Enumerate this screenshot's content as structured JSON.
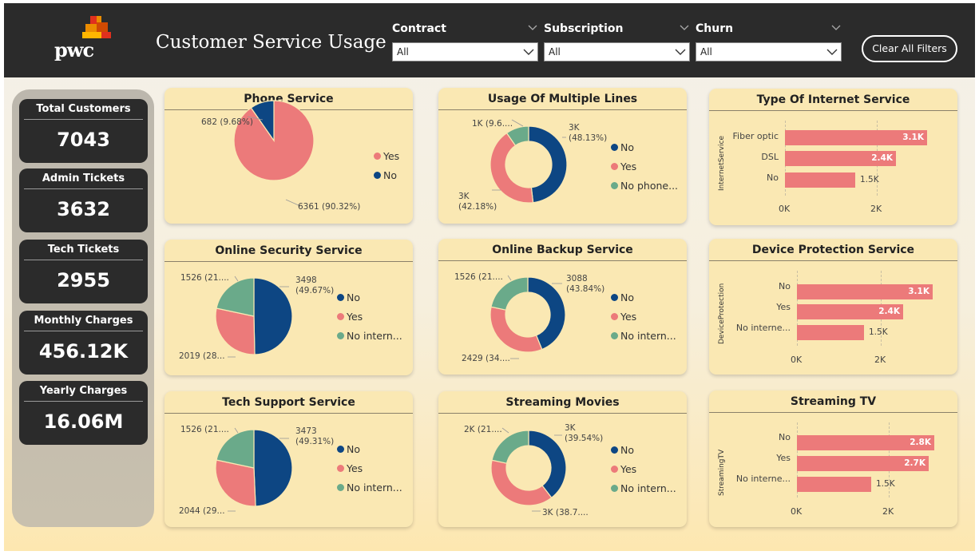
{
  "header": {
    "logo_text": "pwc",
    "title": "Customer Service Usage",
    "filters": [
      {
        "label": "Contract",
        "value": "All"
      },
      {
        "label": "Subscription",
        "value": "All"
      },
      {
        "label": "Churn",
        "value": "All"
      }
    ],
    "clear_button": "Clear All Filters"
  },
  "kpis": [
    {
      "label": "Total Customers",
      "value": "7043"
    },
    {
      "label": "Admin Tickets",
      "value": "3632"
    },
    {
      "label": "Tech Tickets",
      "value": "2955"
    },
    {
      "label": "Monthly Charges",
      "value": "456.12K"
    },
    {
      "label": "Yearly Charges",
      "value": "16.06M"
    }
  ],
  "colors": {
    "navy": "#0d4683",
    "salmon": "#ec7a7a",
    "green": "#6aaa8a",
    "card": "#fae8b3",
    "dark": "#2b2b2b"
  },
  "chart_data": [
    {
      "type": "pie",
      "title": "Phone Service",
      "legend": [
        "Yes",
        "No"
      ],
      "values": [
        6361,
        682
      ],
      "data_labels": [
        "6361 (90.32%)",
        "682 (9.68%)"
      ]
    },
    {
      "type": "pie",
      "subtype": "donut",
      "title": "Usage Of Multiple Lines",
      "legend": [
        "No",
        "Yes",
        "No phone..."
      ],
      "values": [
        3390,
        2971,
        682
      ],
      "data_labels": [
        "3K\n(48.13%)",
        "3K\n(42.18%)",
        "1K (9.6...."
      ]
    },
    {
      "type": "bar",
      "orientation": "horizontal",
      "title": "Type Of Internet Service",
      "ylabel": "InternetService",
      "categories": [
        "Fiber optic",
        "DSL",
        "No"
      ],
      "values": [
        3096,
        2421,
        1526
      ],
      "data_labels": [
        "3.1K",
        "2.4K",
        "1.5K"
      ],
      "x_ticks": [
        "0K",
        "2K"
      ]
    },
    {
      "type": "pie",
      "title": "Online Security Service",
      "legend": [
        "No",
        "Yes",
        "No intern..."
      ],
      "values": [
        3498,
        2019,
        1526
      ],
      "data_labels": [
        "3498\n(49.67%)",
        "2019 (28...",
        "1526 (21...."
      ]
    },
    {
      "type": "pie",
      "subtype": "donut",
      "title": "Online Backup Service",
      "legend": [
        "No",
        "Yes",
        "No intern..."
      ],
      "values": [
        3088,
        2429,
        1526
      ],
      "data_labels": [
        "3088\n(43.84%)",
        "2429 (34....",
        "1526 (21...."
      ]
    },
    {
      "type": "bar",
      "orientation": "horizontal",
      "title": "Device Protection Service",
      "ylabel": "DeviceProtection",
      "categories": [
        "No",
        "Yes",
        "No interne..."
      ],
      "values": [
        3095,
        2422,
        1526
      ],
      "data_labels": [
        "3.1K",
        "2.4K",
        "1.5K"
      ],
      "x_ticks": [
        "0K",
        "2K"
      ]
    },
    {
      "type": "pie",
      "title": "Tech Support Service",
      "legend": [
        "No",
        "Yes",
        "No intern..."
      ],
      "values": [
        3473,
        2044,
        1526
      ],
      "data_labels": [
        "3473\n(49.31%)",
        "2044 (29...",
        "1526 (21...."
      ]
    },
    {
      "type": "pie",
      "subtype": "donut",
      "title": "Streaming Movies",
      "legend": [
        "No",
        "Yes",
        "No intern..."
      ],
      "values": [
        2785,
        2732,
        1526
      ],
      "data_labels": [
        "3K\n(39.54%)",
        "3K (38.7....",
        "2K (21...."
      ]
    },
    {
      "type": "bar",
      "orientation": "horizontal",
      "title": "Streaming TV",
      "ylabel": "StreamingTV",
      "categories": [
        "No",
        "Yes",
        "No interne..."
      ],
      "values": [
        2810,
        2707,
        1526
      ],
      "data_labels": [
        "2.8K",
        "2.7K",
        "1.5K"
      ],
      "x_ticks": [
        "0K",
        "2K"
      ]
    }
  ]
}
